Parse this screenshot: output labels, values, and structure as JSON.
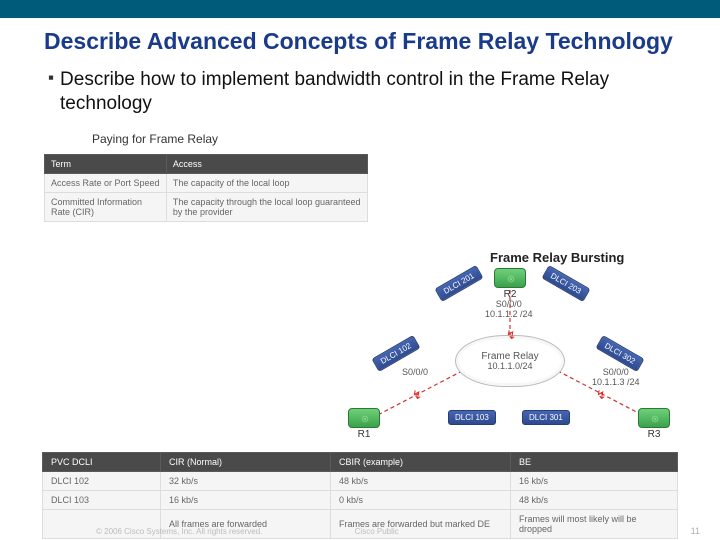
{
  "title": "Describe Advanced Concepts of Frame Relay Technology",
  "bullet": "Describe how to implement bandwidth control in the Frame Relay technology",
  "subtitle": "Paying for Frame Relay",
  "terms": {
    "headers": [
      "Term",
      "Access"
    ],
    "rows": [
      {
        "term": "Access Rate or Port Speed",
        "access": "The capacity of the local loop"
      },
      {
        "term": "Committed Information Rate (CIR)",
        "access": "The capacity through the local loop guaranteed by the provider"
      }
    ]
  },
  "diagram": {
    "title": "Frame Relay Bursting",
    "cloud": {
      "label": "Frame Relay",
      "ip": "10.1.1.0/24"
    },
    "r1": {
      "name": "R1"
    },
    "r2": {
      "name": "R2",
      "if": "S0/0/0",
      "ip": "10.1.1.2 /24"
    },
    "r3": {
      "name": "R3",
      "if": "S0/0/0",
      "ip": "10.1.1.3 /24"
    },
    "s000": "S0/0/0",
    "dlci": {
      "d201": "DLCI 201",
      "d203": "DLCI 203",
      "d102": "DLCI 102",
      "d302": "DLCI 302",
      "d103": "DLCI 103",
      "d301": "DLCI 301"
    }
  },
  "pvc": {
    "headers": [
      "PVC DCLI",
      "CIR (Normal)",
      "CBIR (example)",
      "BE"
    ],
    "rows": [
      {
        "c0": "DLCI 102",
        "c1": "32 kb/s",
        "c2": "48 kb/s",
        "c3": "16 kb/s"
      },
      {
        "c0": "DLCI 103",
        "c1": "16 kb/s",
        "c2": "0 kb/s",
        "c3": "48 kb/s"
      },
      {
        "c0": "",
        "c1": "All frames are forwarded",
        "c2": "Frames are forwarded but marked DE",
        "c3": "Frames will most likely will be dropped"
      }
    ]
  },
  "footer": {
    "copy": "© 2006 Cisco Systems, Inc. All rights reserved.",
    "cp": "Cisco Public",
    "page": "11"
  }
}
